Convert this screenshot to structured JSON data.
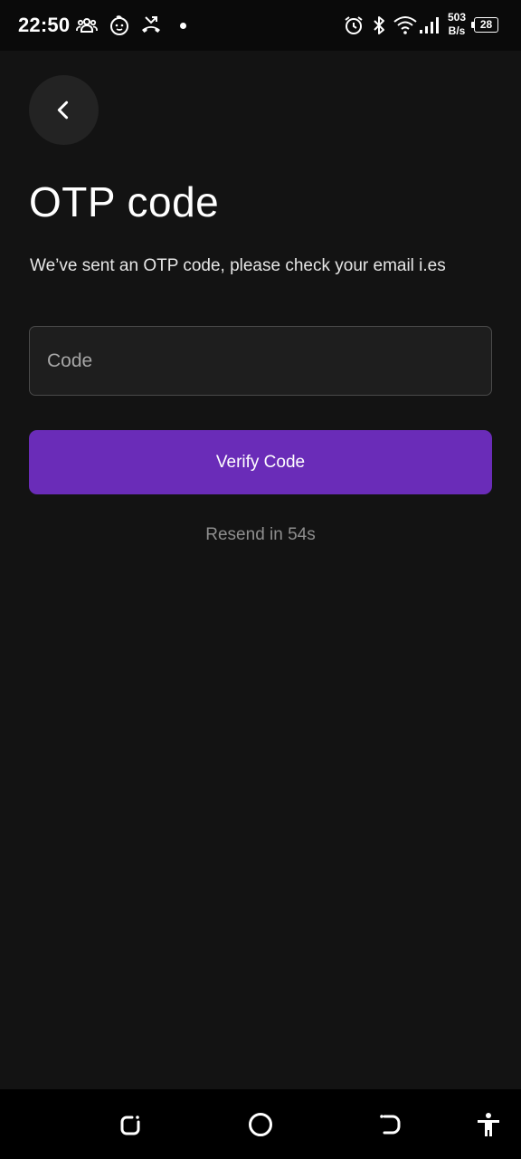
{
  "status_bar": {
    "time": "22:50",
    "net_speed_value": "503",
    "net_speed_unit": "B/s",
    "battery_level": "28",
    "icons": [
      "people-icon",
      "baby-face-icon",
      "missed-call-icon",
      "notification-dot",
      "alarm-icon",
      "bluetooth-icon",
      "wifi-icon",
      "signal-icon",
      "battery-icon"
    ]
  },
  "header": {
    "back_icon": "chevron-left-icon",
    "title": "OTP code",
    "subtitle": "We’ve sent an OTP code, please check your email i.es"
  },
  "form": {
    "code_value": "",
    "code_placeholder": "Code",
    "verify_label": "Verify Code",
    "resend_text": "Resend in 54s"
  },
  "nav_bar": {
    "icons": [
      "recent-apps-icon",
      "home-icon",
      "back-icon",
      "accessibility-icon"
    ]
  },
  "colors": {
    "background": "#131313",
    "accent": "#6a2cb8",
    "input_background": "#1e1e1e",
    "muted_text": "#8e8e8e"
  }
}
